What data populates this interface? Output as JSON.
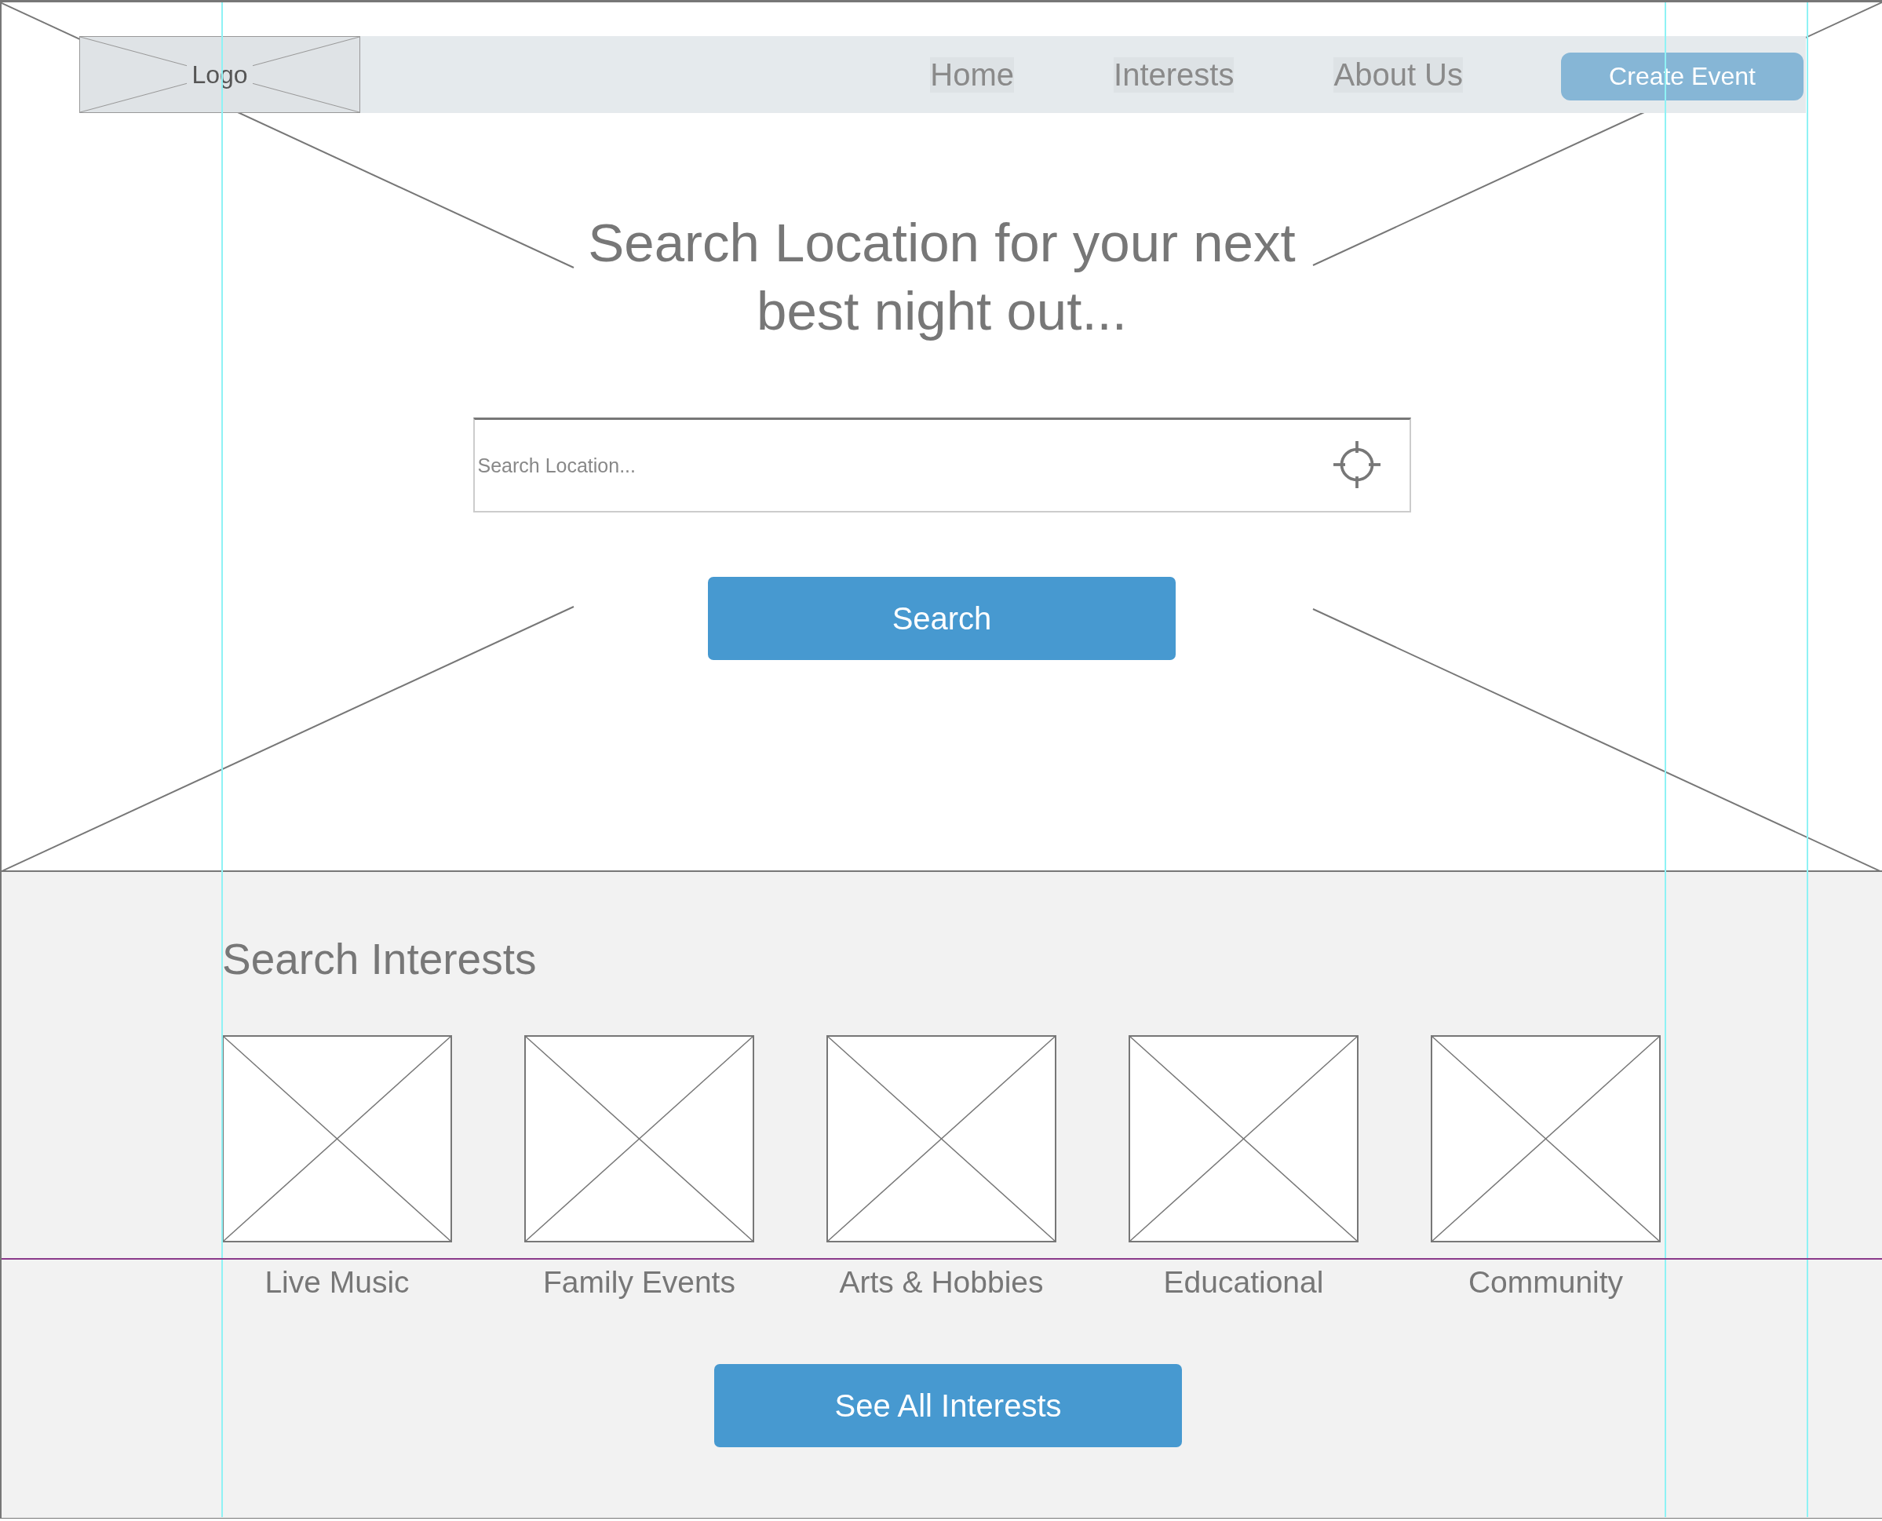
{
  "nav": {
    "logo": "Logo",
    "links": [
      {
        "label": "Home"
      },
      {
        "label": "Interests"
      },
      {
        "label": "About Us"
      }
    ],
    "action": "Create Event"
  },
  "hero": {
    "title": "Search Location for your next best night out...",
    "search": {
      "placeholder": "Search Location..."
    },
    "button": "Search"
  },
  "interests": {
    "heading": "Search Interests",
    "items": [
      {
        "label": "Live Music"
      },
      {
        "label": "Family Events"
      },
      {
        "label": "Arts & Hobbies"
      },
      {
        "label": "Educational"
      },
      {
        "label": "Community"
      }
    ],
    "button": "See All Interests"
  }
}
